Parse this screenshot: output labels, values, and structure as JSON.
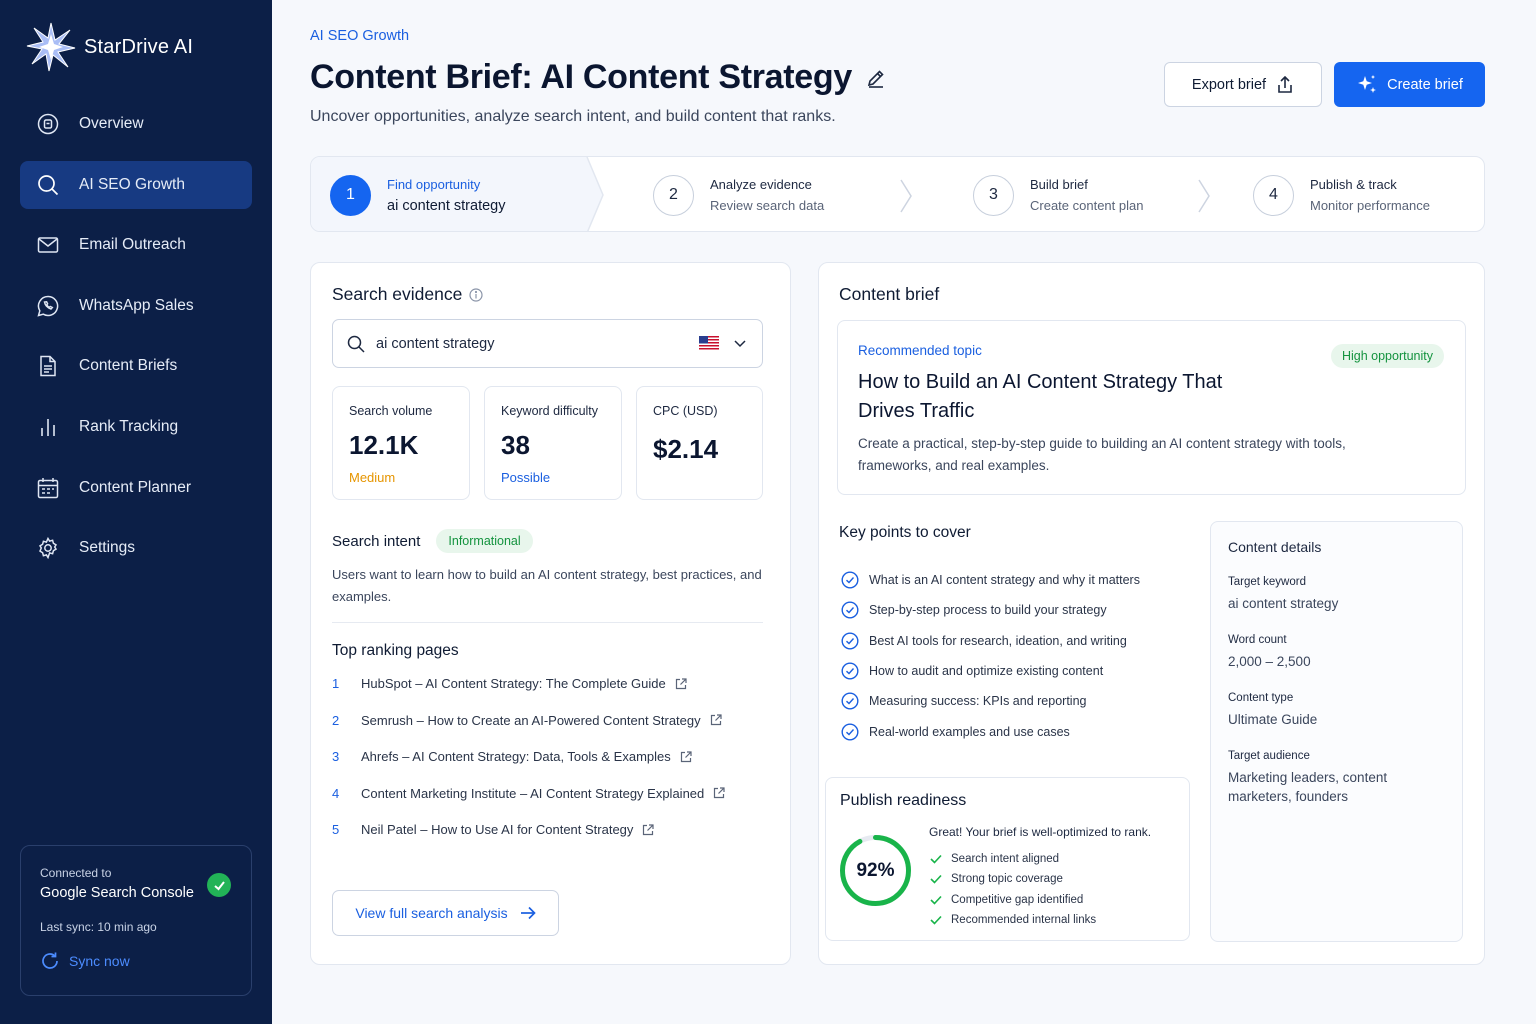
{
  "app": {
    "name": "StarDrive AI"
  },
  "nav": [
    {
      "label": "Overview",
      "icon": "overview-icon"
    },
    {
      "label": "AI SEO Growth",
      "icon": "search-icon"
    },
    {
      "label": "Email Outreach",
      "icon": "mail-icon"
    },
    {
      "label": "WhatsApp Sales",
      "icon": "whatsapp-icon"
    },
    {
      "label": "Content Briefs",
      "icon": "document-icon"
    },
    {
      "label": "Rank Tracking",
      "icon": "bar-chart-icon"
    },
    {
      "label": "Content Planner",
      "icon": "calendar-icon"
    },
    {
      "label": "Settings",
      "icon": "gear-icon"
    }
  ],
  "connection": {
    "label": "Connected to",
    "service": "Google Search Console",
    "last_sync": "Last sync: 10 min ago",
    "sync_label": "Sync now"
  },
  "header": {
    "breadcrumb": "AI SEO Growth",
    "title": "Content Brief: AI Content Strategy",
    "subtitle": "Uncover opportunities, analyze search intent, and build content that ranks.",
    "export_label": "Export brief",
    "create_label": "Create brief"
  },
  "steps": [
    {
      "num": "1",
      "title": "Find opportunity",
      "sub": "ai content strategy"
    },
    {
      "num": "2",
      "title": "Analyze evidence",
      "sub": "Review search data"
    },
    {
      "num": "3",
      "title": "Build brief",
      "sub": "Create content plan"
    },
    {
      "num": "4",
      "title": "Publish & track",
      "sub": "Monitor performance"
    }
  ],
  "evidence": {
    "title": "Search evidence",
    "query": "ai content strategy",
    "metrics": [
      {
        "label": "Search volume",
        "value": "12.1K",
        "tag": "Medium",
        "tag_color": "#e69500"
      },
      {
        "label": "Keyword difficulty",
        "value": "38",
        "tag": "Possible",
        "tag_color": "#1a5fe0"
      },
      {
        "label": "CPC (USD)",
        "value": "$2.14",
        "tag": "",
        "tag_color": ""
      }
    ],
    "intent_label": "Search intent",
    "intent_value": "Informational",
    "intent_desc": "Users want to learn how to build an AI content strategy, best practices, and examples.",
    "top_title": "Top ranking pages",
    "top_pages": [
      {
        "num": "1",
        "text": "HubSpot – AI Content Strategy: The Complete Guide"
      },
      {
        "num": "2",
        "text": "Semrush – How to Create an AI-Powered Content Strategy"
      },
      {
        "num": "3",
        "text": "Ahrefs – AI Content Strategy: Data, Tools & Examples"
      },
      {
        "num": "4",
        "text": "Content Marketing Institute – AI Content Strategy Explained"
      },
      {
        "num": "5",
        "text": "Neil Patel – How to Use AI for Content Strategy"
      }
    ],
    "view_label": "View full search analysis"
  },
  "brief": {
    "title": "Content brief",
    "topic_label": "Recommended topic",
    "topic_title": "How to Build an AI Content Strategy That Drives Traffic",
    "topic_desc": "Create a practical, step-by-step guide to building an AI content strategy with tools, frameworks, and real examples.",
    "topic_badge": "High opportunity",
    "key_title": "Key points to cover",
    "key_points": [
      "What is an AI content strategy and why it matters",
      "Step-by-step process to build your strategy",
      "Best AI tools for research, ideation, and writing",
      "How to audit and optimize existing content",
      "Measuring success: KPIs and reporting",
      "Real-world examples and use cases"
    ],
    "readiness": {
      "title": "Publish readiness",
      "percent_label": "92%",
      "percent": 92,
      "message": "Great! Your brief is well-optimized to rank.",
      "items": [
        "Search intent aligned",
        "Strong topic coverage",
        "Competitive gap identified",
        "Recommended internal links"
      ]
    },
    "details": {
      "title": "Content details",
      "fields": [
        {
          "label": "Target keyword",
          "value": "ai content strategy"
        },
        {
          "label": "Word count",
          "value": "2,000 – 2,500"
        },
        {
          "label": "Content type",
          "value": "Ultimate Guide"
        },
        {
          "label": "Target audience",
          "value": "Marketing leaders, content marketers, founders"
        }
      ]
    }
  },
  "colors": {
    "primary": "#1565f0",
    "sidebar": "#0c1f47",
    "active_nav": "#173a82",
    "success": "#22b357"
  }
}
